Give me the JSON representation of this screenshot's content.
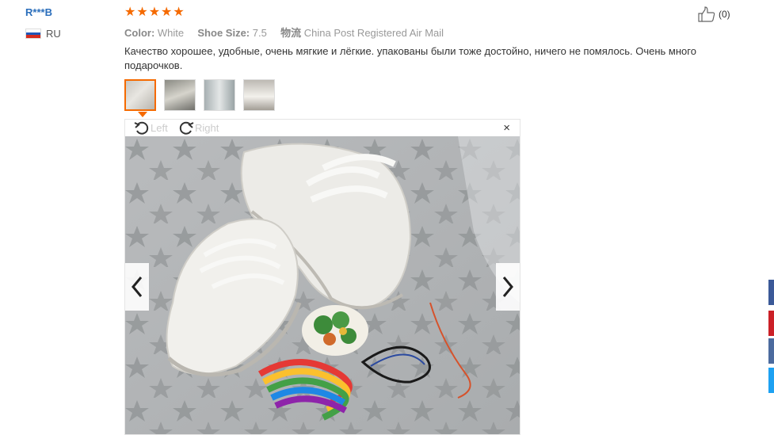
{
  "reviewer": {
    "name": "R***B",
    "country": "RU"
  },
  "rating": {
    "stars": 5
  },
  "helpful": {
    "count": "(0)"
  },
  "attributes": [
    {
      "label": "Color:",
      "value": "White"
    },
    {
      "label": "Shoe Size:",
      "value": "7.5"
    },
    {
      "label": "物流",
      "value": "China Post Registered Air Mail"
    }
  ],
  "review": {
    "text": "Качество хорошее, удобные, очень мягкие и лёгкие. упакованы были тоже достойно, ничего не помялось. Очень много подарочков."
  },
  "viewer": {
    "rotate_left": "Left",
    "rotate_right": "Right",
    "close": "×"
  },
  "share_colors": [
    "#3b5998",
    "#cb2027",
    "#4c6b9e",
    "#1da1f2"
  ]
}
